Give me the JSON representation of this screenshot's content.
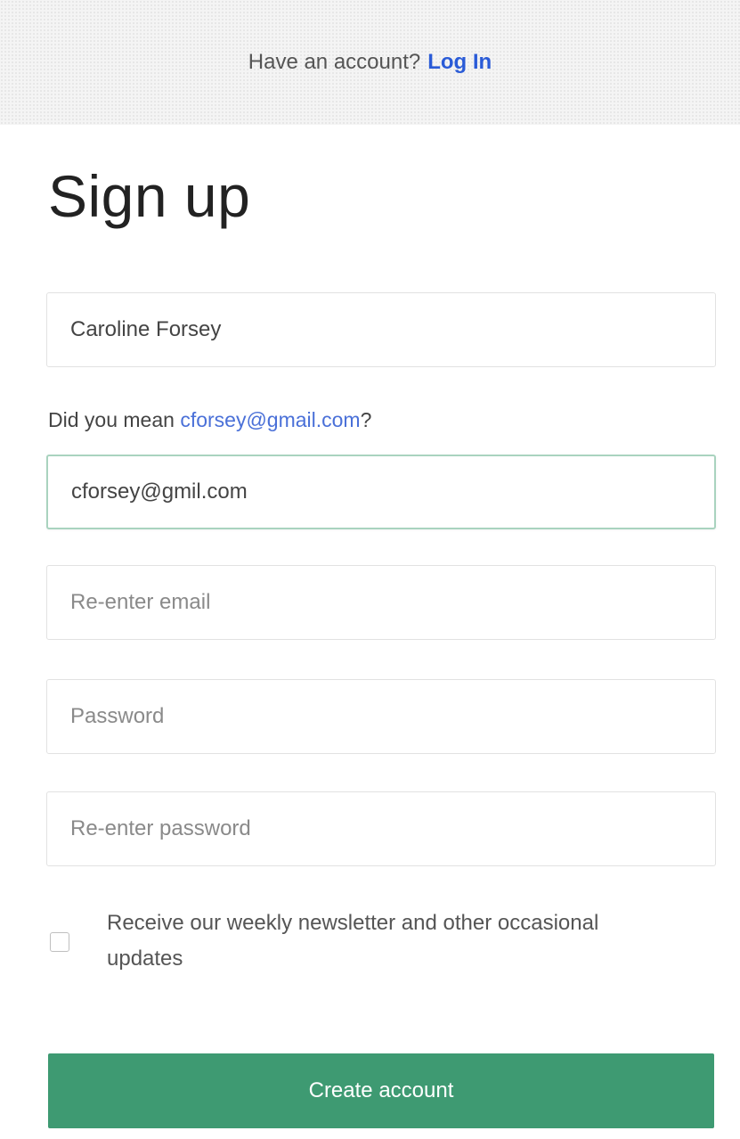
{
  "banner": {
    "prompt": "Have an account?",
    "login_label": "Log In"
  },
  "title": "Sign up",
  "form": {
    "name_value": "Caroline Forsey",
    "suggestion_prefix": "Did you mean ",
    "suggestion_email": "cforsey@gmail.com",
    "suggestion_suffix": "?",
    "email_value": "cforsey@gmil.com",
    "reenter_email_placeholder": "Re-enter email",
    "password_placeholder": "Password",
    "reenter_password_placeholder": "Re-enter password",
    "newsletter_label": "Receive our weekly newsletter and other occasional updates",
    "newsletter_checked": false,
    "submit_label": "Create account"
  },
  "colors": {
    "accent_green": "#3e9a72",
    "link_blue": "#2a5bd7",
    "focus_border": "#a9d3bf"
  }
}
